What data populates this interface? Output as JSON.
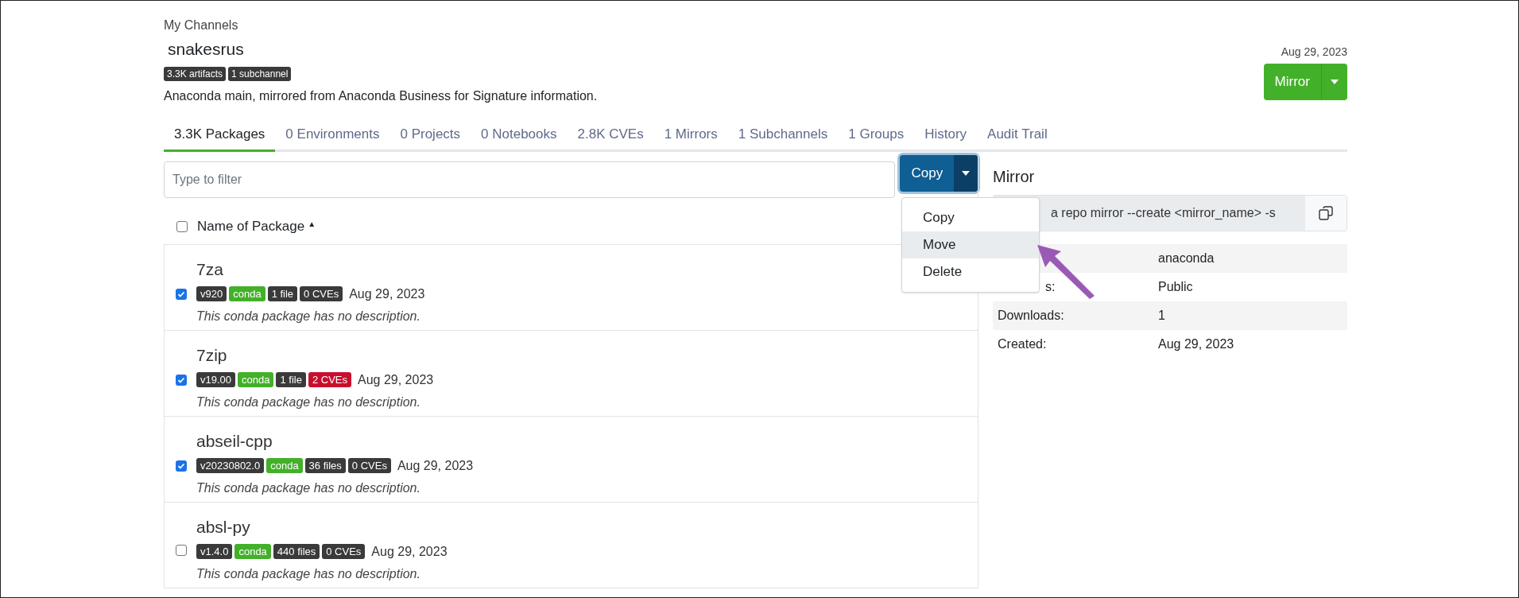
{
  "breadcrumb": "My Channels",
  "channel": {
    "name": "snakesrus",
    "badges": [
      "3.3K artifacts",
      "1 subchannel"
    ],
    "description": "Anaconda main, mirrored from Anaconda Business for Signature information.",
    "date": "Aug 29, 2023"
  },
  "mirror_button": {
    "label": "Mirror"
  },
  "tabs": [
    {
      "label": "3.3K Packages",
      "selected": true
    },
    {
      "label": "0 Environments",
      "selected": false
    },
    {
      "label": "0 Projects",
      "selected": false
    },
    {
      "label": "0 Notebooks",
      "selected": false
    },
    {
      "label": "2.8K CVEs",
      "selected": false
    },
    {
      "label": "1 Mirrors",
      "selected": false
    },
    {
      "label": "1 Subchannels",
      "selected": false
    },
    {
      "label": "1 Groups",
      "selected": false
    },
    {
      "label": "History",
      "selected": false
    },
    {
      "label": "Audit Trail",
      "selected": false
    }
  ],
  "filter": {
    "placeholder": "Type to filter"
  },
  "copy_button": {
    "label": "Copy"
  },
  "menu": {
    "items": [
      {
        "label": "Copy",
        "selected": false
      },
      {
        "label": "Move",
        "selected": true
      },
      {
        "label": "Delete",
        "selected": false
      }
    ]
  },
  "list_header": {
    "label": "Name of Package",
    "checked": false,
    "sort_icon": "▲"
  },
  "packages": [
    {
      "name": "7za",
      "checked": true,
      "badges": [
        {
          "text": "v920",
          "color": "#3a3a3a"
        },
        {
          "text": "conda",
          "color": "#43b02a"
        },
        {
          "text": "1 file",
          "color": "#3a3a3a"
        },
        {
          "text": "0 CVEs",
          "color": "#3a3a3a"
        }
      ],
      "date": "Aug 29, 2023",
      "description": "This conda package has no description."
    },
    {
      "name": "7zip",
      "checked": true,
      "badges": [
        {
          "text": "v19.00",
          "color": "#3a3a3a"
        },
        {
          "text": "conda",
          "color": "#43b02a"
        },
        {
          "text": "1 file",
          "color": "#3a3a3a"
        },
        {
          "text": "2 CVEs",
          "color": "#c8102e"
        }
      ],
      "date": "Aug 29, 2023",
      "description": "This conda package has no description."
    },
    {
      "name": "abseil-cpp",
      "checked": true,
      "badges": [
        {
          "text": "v20230802.0",
          "color": "#3a3a3a"
        },
        {
          "text": "conda",
          "color": "#43b02a"
        },
        {
          "text": "36 files",
          "color": "#3a3a3a"
        },
        {
          "text": "0 CVEs",
          "color": "#3a3a3a"
        }
      ],
      "date": "Aug 29, 2023",
      "description": "This conda package has no description."
    },
    {
      "name": "absl-py",
      "checked": false,
      "badges": [
        {
          "text": "v1.4.0",
          "color": "#3a3a3a"
        },
        {
          "text": "conda",
          "color": "#43b02a"
        },
        {
          "text": "440 files",
          "color": "#3a3a3a"
        },
        {
          "text": "0 CVEs",
          "color": "#3a3a3a"
        }
      ],
      "date": "Aug 29, 2023",
      "description": "This conda package has no description."
    }
  ],
  "mirror_panel": {
    "title": "Mirror",
    "command": "a repo mirror --create <mirror_name> -s",
    "rows": [
      {
        "label": "",
        "value": "anaconda"
      },
      {
        "label": "s:",
        "value": "Public"
      },
      {
        "label": "Downloads:",
        "value": "1"
      },
      {
        "label": "Created:",
        "value": "Aug 29, 2023"
      }
    ]
  }
}
